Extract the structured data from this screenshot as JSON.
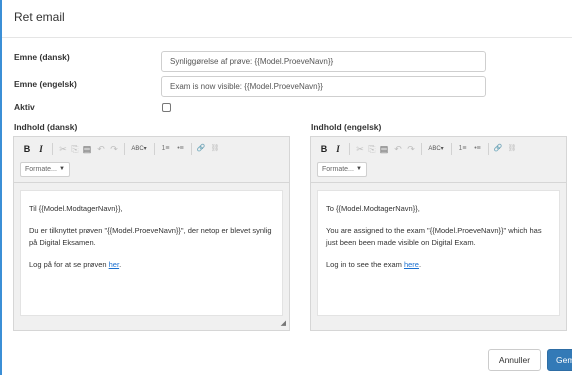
{
  "dialog": {
    "title": "Ret email"
  },
  "fields": {
    "subject_da": {
      "label": "Emne (dansk)",
      "value": "Synliggørelse af prøve: {{Model.ProeveNavn}}"
    },
    "subject_en": {
      "label": "Emne (engelsk)",
      "value": "Exam is now visible: {{Model.ProeveNavn}}"
    },
    "active": {
      "label": "Aktiv",
      "checked": false
    }
  },
  "editor_da": {
    "label": "Indhold (dansk)",
    "format_label": "Formate...",
    "paragraphs": [
      "Til {{Model.ModtagerNavn}},",
      "Du er tilknyttet prøven \"{{Model.ProeveNavn}}\", der netop er blevet synlig på Digital Eksamen.",
      "Log på for at se prøven "
    ],
    "link_text": "her",
    "trailing": "."
  },
  "editor_en": {
    "label": "Indhold (engelsk)",
    "format_label": "Formate...",
    "paragraphs": [
      "To {{Model.ModtagerNavn}},",
      "You are assigned to the exam \"{{Model.ProeveNavn}}\" which has just been been made visible on Digital Exam.",
      "Log in to see the exam "
    ],
    "link_text": "here",
    "trailing": "."
  },
  "toolbar": {
    "bold": "B",
    "italic": "I",
    "cut": "✂",
    "copy": "⎘",
    "paste": "▤",
    "undo": "↶",
    "redo": "↷",
    "spellcheck": "ABC▾",
    "numbered_list": "1≡",
    "bullet_list": "•≡",
    "link": "🔗",
    "unlink": "⛓"
  },
  "buttons": {
    "cancel": "Annuller",
    "save": "Gem"
  },
  "colors": {
    "accent": "#337ab7",
    "frame_border": "#3b8fd6",
    "link": "#1a6fd0"
  }
}
